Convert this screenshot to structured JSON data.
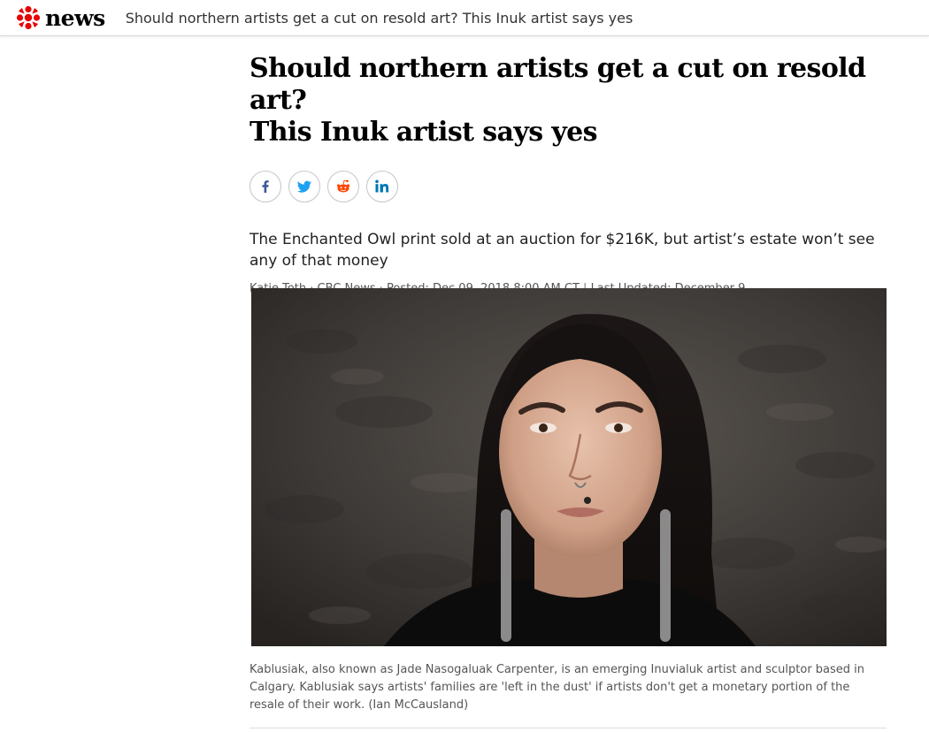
{
  "header": {
    "brand_word": "news",
    "title": "Should northern artists get a cut on resold art? This Inuk artist says yes"
  },
  "article": {
    "headline_line1": "Should northern artists get a cut on resold art?",
    "headline_line2": "This Inuk artist says yes",
    "share": [
      {
        "name": "facebook",
        "icon": "facebook-icon",
        "color": "#3b5998"
      },
      {
        "name": "twitter",
        "icon": "twitter-icon",
        "color": "#1da1f2"
      },
      {
        "name": "reddit",
        "icon": "reddit-icon",
        "color": "#ff4500"
      },
      {
        "name": "linkedin",
        "icon": "linkedin-icon",
        "color": "#0077b5"
      }
    ],
    "deck": "The Enchanted Owl print sold at an auction for $216K, but artist’s estate won’t see any of that money",
    "byline": {
      "author": "Katie Toth",
      "outlet": "CBC News",
      "posted": "Posted: Dec 09, 2018 8:00 AM CT",
      "updated": "Last Updated: December 9"
    },
    "caption": {
      "text": "Kablusiak, also known as Jade Nasogaluak Carpenter, is an emerging Inuvialuk artist and sculptor based in Calgary. Kablusiak says artists' families are 'left in the dust' if artists don't get a monetary portion of the resale of their work.",
      "credit": "(Ian McCausland)"
    }
  },
  "colors": {
    "brand_red": "#e60505",
    "text_dark": "#000000",
    "meta_gray": "#555555"
  }
}
